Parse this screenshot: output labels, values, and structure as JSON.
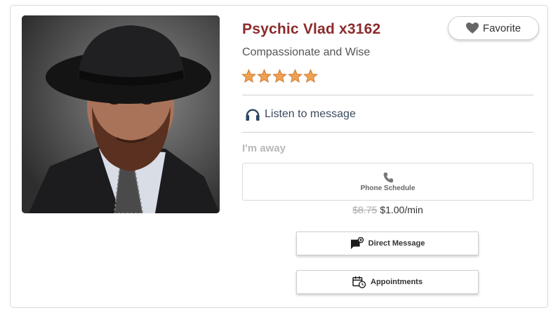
{
  "profile": {
    "name": "Psychic Vlad x3162",
    "tagline": "Compassionate and Wise",
    "rating": 5,
    "rating_max": 5,
    "favorite_label": "Favorite",
    "listen_label": "Listen to message",
    "status": "I'm away",
    "phone_schedule_label": "Phone Schedule",
    "price_old": "$8.75",
    "price_new": "$1.00/min",
    "direct_message_label": "Direct Message",
    "appointments_label": "Appointments"
  },
  "colors": {
    "name": "#8c2b2b",
    "star": "#f0a050",
    "status": "#b8b8b8"
  },
  "icons": {
    "favorite": "heart-icon",
    "listen": "headphones-icon",
    "phone": "phone-icon",
    "direct_message": "chat-plus-icon",
    "appointments": "calendar-clock-icon"
  }
}
